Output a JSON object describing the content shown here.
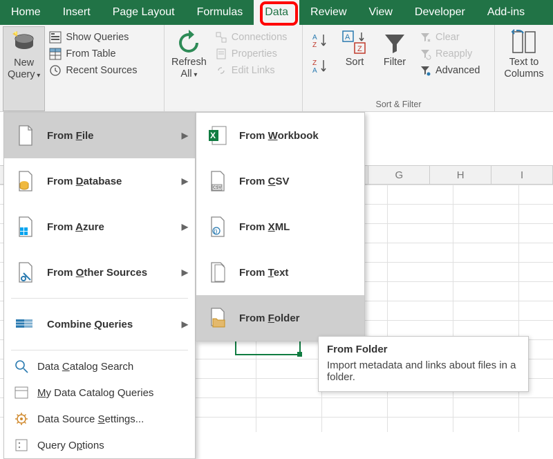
{
  "tabs": [
    "Home",
    "Insert",
    "Page Layout",
    "Formulas",
    "Data",
    "Review",
    "View",
    "Developer",
    "Add-ins"
  ],
  "active_tab_index": 4,
  "ribbon": {
    "new_query": {
      "line1": "New",
      "line2": "Query"
    },
    "show_queries": "Show Queries",
    "from_table": "From Table",
    "recent_sources": "Recent Sources",
    "refresh_all": {
      "line1": "Refresh",
      "line2": "All"
    },
    "connections": "Connections",
    "properties": "Properties",
    "edit_links": "Edit Links",
    "sort": "Sort",
    "filter": "Filter",
    "clear": "Clear",
    "reapply": "Reapply",
    "advanced": "Advanced",
    "sort_filter_group": "Sort & Filter",
    "text_to_cols": {
      "line1": "Text to",
      "line2": "Columns"
    }
  },
  "menu1": {
    "from_file": "From File",
    "from_database": "From Database",
    "from_azure": "From Azure",
    "from_other": "From Other Sources",
    "combine": "Combine Queries",
    "data_catalog_search": "Data Catalog Search",
    "my_data_catalog": "My Data Catalog Queries",
    "data_source_settings": "Data Source Settings...",
    "query_options": "Query Options"
  },
  "menu2": {
    "from_workbook": "From Workbook",
    "from_csv": "From CSV",
    "from_xml": "From XML",
    "from_text": "From Text",
    "from_folder": "From Folder"
  },
  "tooltip": {
    "title": "From Folder",
    "body": "Import metadata and links about files in a folder."
  },
  "columns": [
    "",
    "",
    "",
    "",
    "",
    "",
    "G",
    "H",
    "I"
  ]
}
